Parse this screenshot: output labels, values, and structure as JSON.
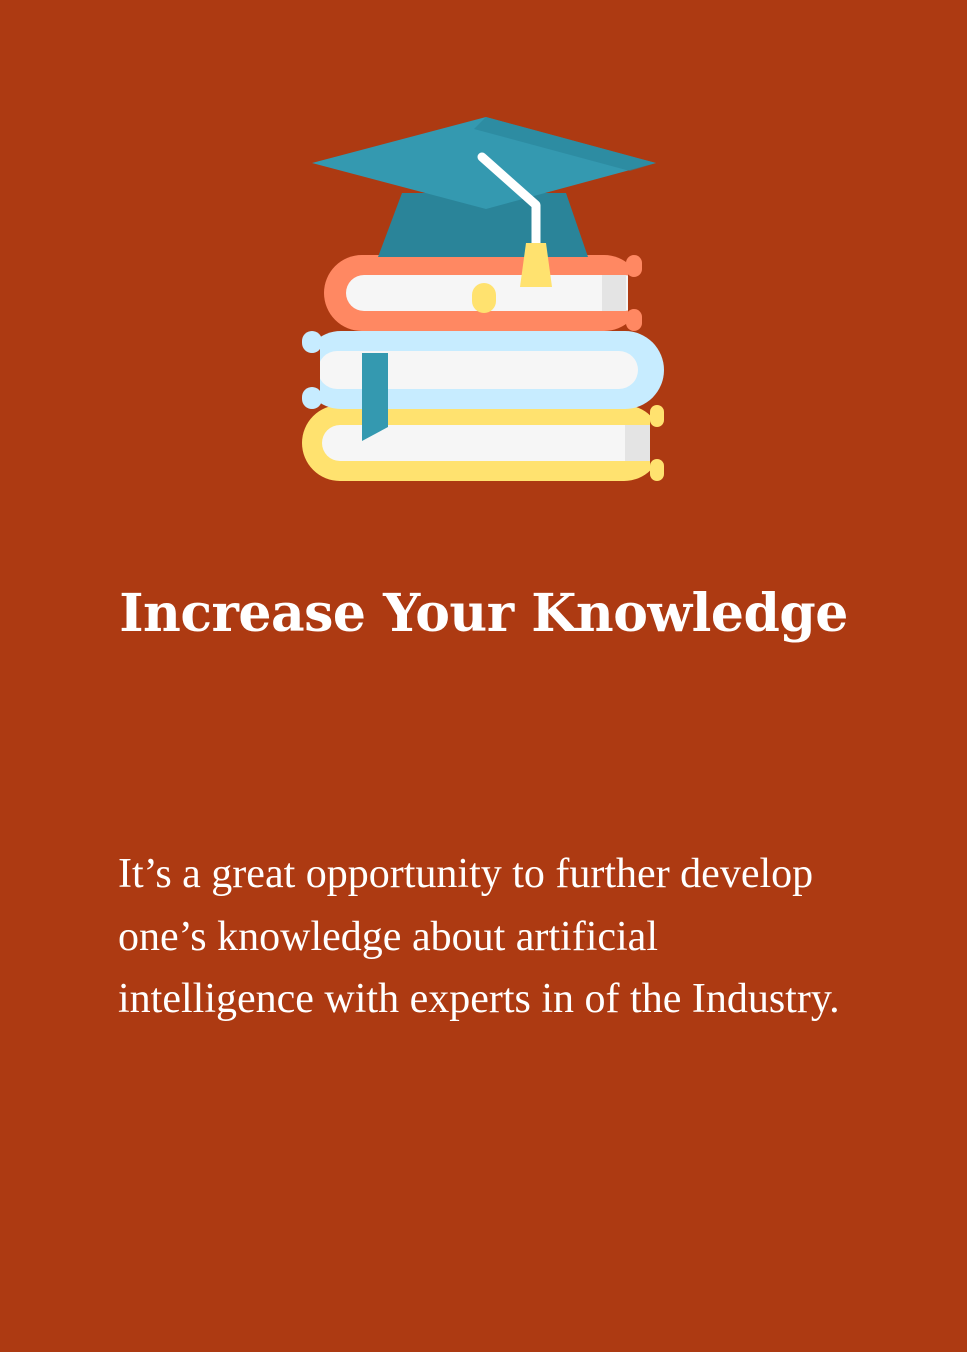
{
  "card": {
    "background_color": "#ad3a12",
    "icon": "graduation-cap-on-books-icon",
    "title": "Increase Your Knowledge",
    "description": "It’s a great opportunity to further develop one’s knowledge about artificial intelligence with experts in of the Industry."
  },
  "colors": {
    "text": "#ffffff",
    "cap": "#3499b0",
    "cap_dark": "#2a8499",
    "tassel": "#ffe26f",
    "book_top": "#ff8862",
    "book_middle": "#c7ecff",
    "book_bottom": "#ffe26f",
    "pages": "#f6f6f6"
  }
}
